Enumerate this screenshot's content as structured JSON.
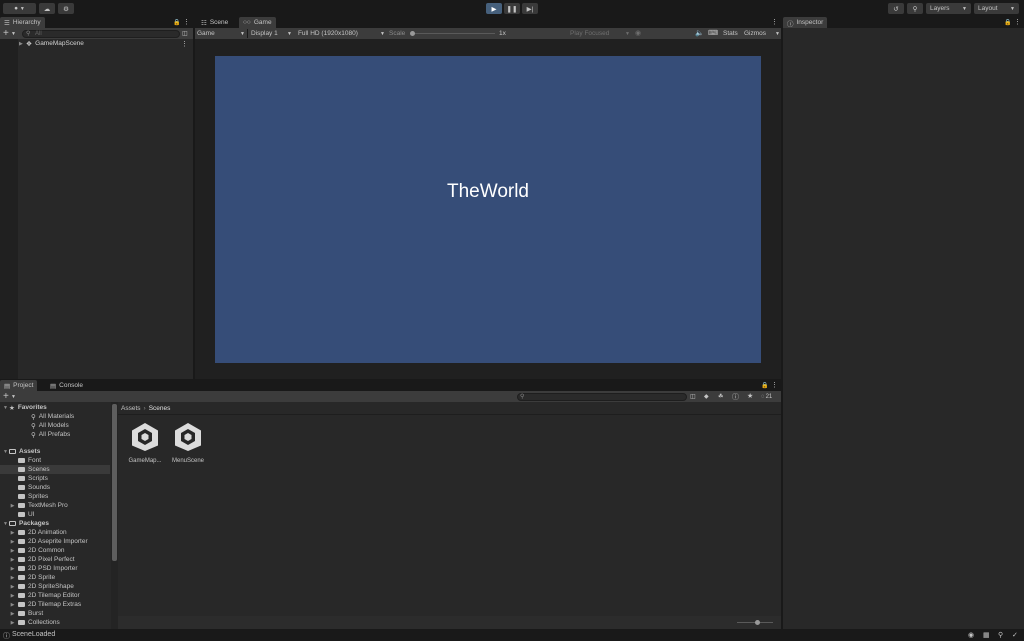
{
  "toolbar": {
    "layers_label": "Layers",
    "layout_label": "Layout"
  },
  "hierarchy": {
    "tab_label": "Hierarchy",
    "search_placeholder": "All",
    "scene_name": "GameMapScene"
  },
  "view_tabs": {
    "scene_label": "Scene",
    "game_label": "Game"
  },
  "game_toolbar": {
    "view_mode": "Game",
    "display": "Display 1",
    "resolution": "Full HD (1920x1080)",
    "scale_label": "Scale",
    "scale_value": "1x",
    "play_mode": "Play Focused",
    "stats_label": "Stats",
    "gizmos_label": "Gizmos"
  },
  "game_view": {
    "text": "TheWorld",
    "background_color": "#364d78"
  },
  "inspector": {
    "tab_label": "Inspector"
  },
  "bottom_tabs": {
    "project_label": "Project",
    "console_label": "Console"
  },
  "project": {
    "hidden_count": "21",
    "breadcrumb": [
      "Assets",
      "Scenes"
    ],
    "favorites": {
      "label": "Favorites",
      "items": [
        "All Materials",
        "All Models",
        "All Prefabs"
      ]
    },
    "assets": {
      "label": "Assets",
      "items": [
        "Font",
        "Scenes",
        "Scripts",
        "Sounds",
        "Sprites",
        "TextMesh Pro",
        "UI"
      ],
      "selected": "Scenes"
    },
    "packages": {
      "label": "Packages",
      "items": [
        "2D Animation",
        "2D Aseprite Importer",
        "2D Common",
        "2D Pixel Perfect",
        "2D PSD Importer",
        "2D Sprite",
        "2D SpriteShape",
        "2D Tilemap Editor",
        "2D Tilemap Extras",
        "Burst",
        "Collections"
      ]
    },
    "scene_assets": [
      "GameMap...",
      "MenuScene"
    ]
  },
  "status": {
    "message": "SceneLoaded"
  }
}
